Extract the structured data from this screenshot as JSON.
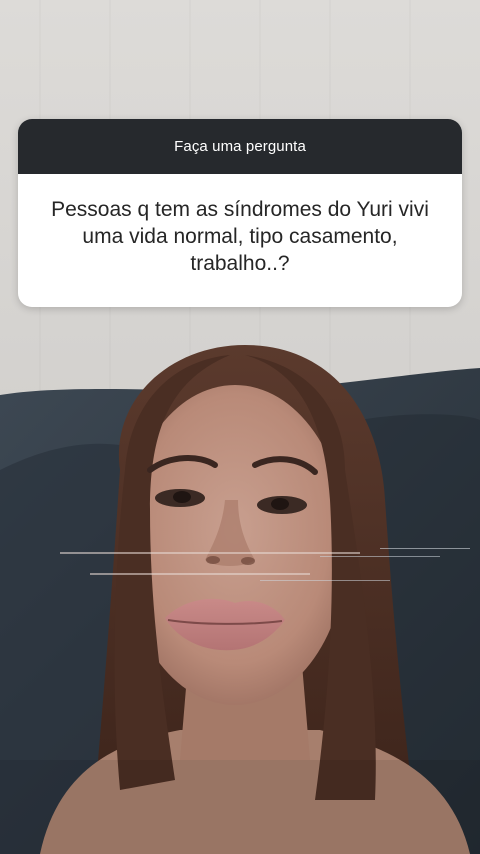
{
  "story": {
    "question_sticker": {
      "header": "Faça uma pergunta",
      "question": "Pessoas q tem as síndromes do Yuri vivi uma vida normal, tipo casamento, trabalho..?"
    },
    "colors": {
      "header_bg": "#26292d",
      "body_bg": "#ffffff",
      "text_dark": "#262626",
      "wall": "#d3d1ce",
      "sofa": "#2f3943"
    }
  }
}
